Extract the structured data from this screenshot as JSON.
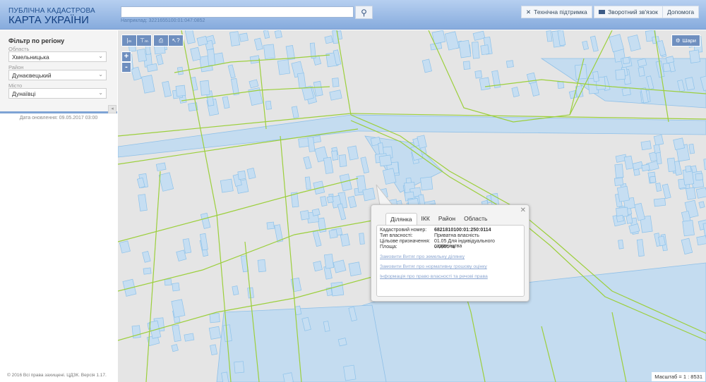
{
  "header": {
    "logo_line1": "ПУБЛІЧНА КАДАСТРОВА",
    "logo_line2": "КАРТА УКРАЇНИ",
    "search_value": "",
    "search_hint": "Наприклад: 3221655100:01:047:0852",
    "buttons": {
      "support": "Технічна підтримка",
      "feedback": "Зворотний зв'язок",
      "help": "Допомога"
    }
  },
  "sidebar": {
    "filter_title": "Фільтр по регіону",
    "oblast_label": "Область",
    "oblast_value": "Хмельницька",
    "raion_label": "Район",
    "raion_value": "Дунаєвецький",
    "misto_label": "Місто",
    "misto_value": "Дунаївці",
    "updated": "Дата оновлення: 09.05.2017 03:00",
    "copyright": "© 2016 Всі права захищені. ЦДЗК. Версія 1.17."
  },
  "map": {
    "layers_label": "Шари",
    "scale": "Масштаб = 1 : 8531",
    "zoom_in": "+",
    "zoom_out": "-"
  },
  "popup": {
    "tabs": [
      "Ділянка",
      "ІКК",
      "Район",
      "Область"
    ],
    "rows": [
      {
        "k": "Кадастровий номер:",
        "v": "6821810100:01:250:0114"
      },
      {
        "k": "Тип власності:",
        "v": "Приватна власність"
      },
      {
        "k": "Цільове призначення:",
        "v": "01.05 Для індивідуального садівництва"
      },
      {
        "k": "Площа:",
        "v": "0.0601 га"
      }
    ],
    "links": [
      "Замовити Витяг про земельну ділянку",
      "Замовити Витяг про нормативну грошову оцінку",
      "Інформація про право власності та речові права"
    ]
  }
}
